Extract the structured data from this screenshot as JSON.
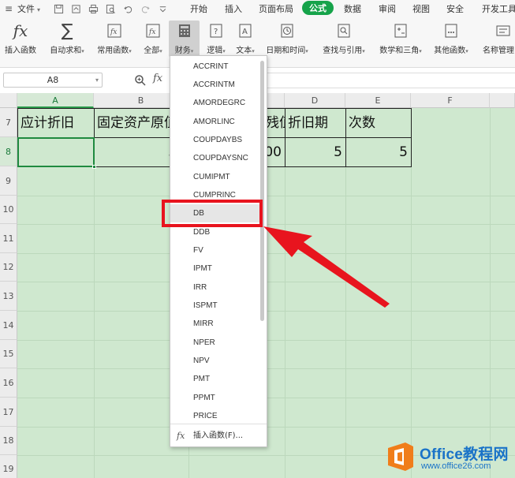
{
  "menubar": {
    "menu_label": "文件",
    "tabs": [
      "开始",
      "插入",
      "页面布局",
      "公式",
      "数据",
      "审阅",
      "视图",
      "安全",
      "开发工具"
    ],
    "active_tab": "公式"
  },
  "ribbon": {
    "insert_function": "插入函数",
    "autosum": "自动求和",
    "common_functions": "常用函数",
    "all": "全部",
    "financial": "财务",
    "logical": "逻辑",
    "text": "文本",
    "datetime": "日期和时间",
    "lookup": "查找与引用",
    "math": "数学和三角",
    "other": "其他函数",
    "name_manager": "名称管理"
  },
  "formula_bar": {
    "name_box": "A8",
    "fx_label": "fx"
  },
  "sheet": {
    "columns": [
      "A",
      "B",
      "C",
      "D",
      "E",
      "F"
    ],
    "rows": [
      "7",
      "8",
      "9",
      "10",
      "11",
      "12",
      "13",
      "14",
      "15",
      "16",
      "17",
      "18",
      "19"
    ],
    "row7": [
      "应计折旧",
      "固定资产原值",
      "残值",
      "折旧期",
      "次数"
    ],
    "row8": [
      "",
      "30",
      "00",
      "5",
      "5"
    ]
  },
  "dropdown": {
    "items": [
      "ACCRINT",
      "ACCRINTM",
      "AMORDEGRC",
      "AMORLINC",
      "COUPDAYBS",
      "COUPDAYSNC",
      "CUMIPMT",
      "CUMPRINC",
      "DB",
      "DDB",
      "FV",
      "IPMT",
      "IRR",
      "ISPMT",
      "MIRR",
      "NPER",
      "NPV",
      "PMT",
      "PPMT",
      "PRICE"
    ],
    "highlighted": "DB",
    "footer": "插入函数(F)..."
  },
  "brand": {
    "name": "Office教程网",
    "url": "www.office26.com"
  },
  "colors": {
    "accent_green": "#16a34a",
    "sheet_green": "#cfe8cf",
    "annotation_red": "#e8141e",
    "brand_blue": "#1a73c8",
    "brand_orange": "#f07d1a"
  }
}
